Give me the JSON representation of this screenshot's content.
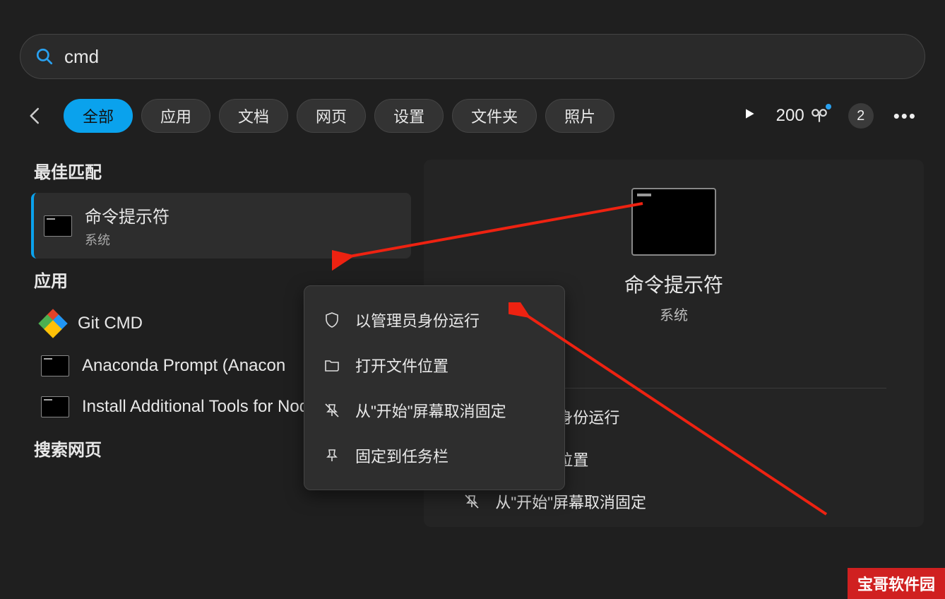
{
  "search": {
    "query": "cmd",
    "placeholder": ""
  },
  "tabs": {
    "items": [
      "全部",
      "应用",
      "文档",
      "网页",
      "设置",
      "文件夹",
      "照片"
    ],
    "activeIndex": 0
  },
  "topbar": {
    "points": "200",
    "notificationCount": "2"
  },
  "sections": {
    "bestMatch": "最佳匹配",
    "apps": "应用",
    "webSearch": "搜索网页"
  },
  "bestResult": {
    "title": "命令提示符",
    "subtitle": "系统"
  },
  "appResults": [
    {
      "title": "Git CMD"
    },
    {
      "title": "Anaconda Prompt (Anacon"
    },
    {
      "title": "Install Additional Tools for Node.js"
    }
  ],
  "contextMenu": {
    "items": [
      {
        "label": "以管理员身份运行",
        "icon": "shield"
      },
      {
        "label": "打开文件位置",
        "icon": "folder"
      },
      {
        "label": "从\"开始\"屏幕取消固定",
        "icon": "unpin"
      },
      {
        "label": "固定到任务栏",
        "icon": "pin"
      }
    ]
  },
  "preview": {
    "title": "命令提示符",
    "subtitle": "系统",
    "actions": [
      {
        "label": "以管理员身份运行",
        "icon": "shield"
      },
      {
        "label": "打开文件位置",
        "icon": "folder"
      },
      {
        "label": "从\"开始\"屏幕取消固定",
        "icon": "unpin"
      }
    ]
  },
  "watermark": "宝哥软件园"
}
